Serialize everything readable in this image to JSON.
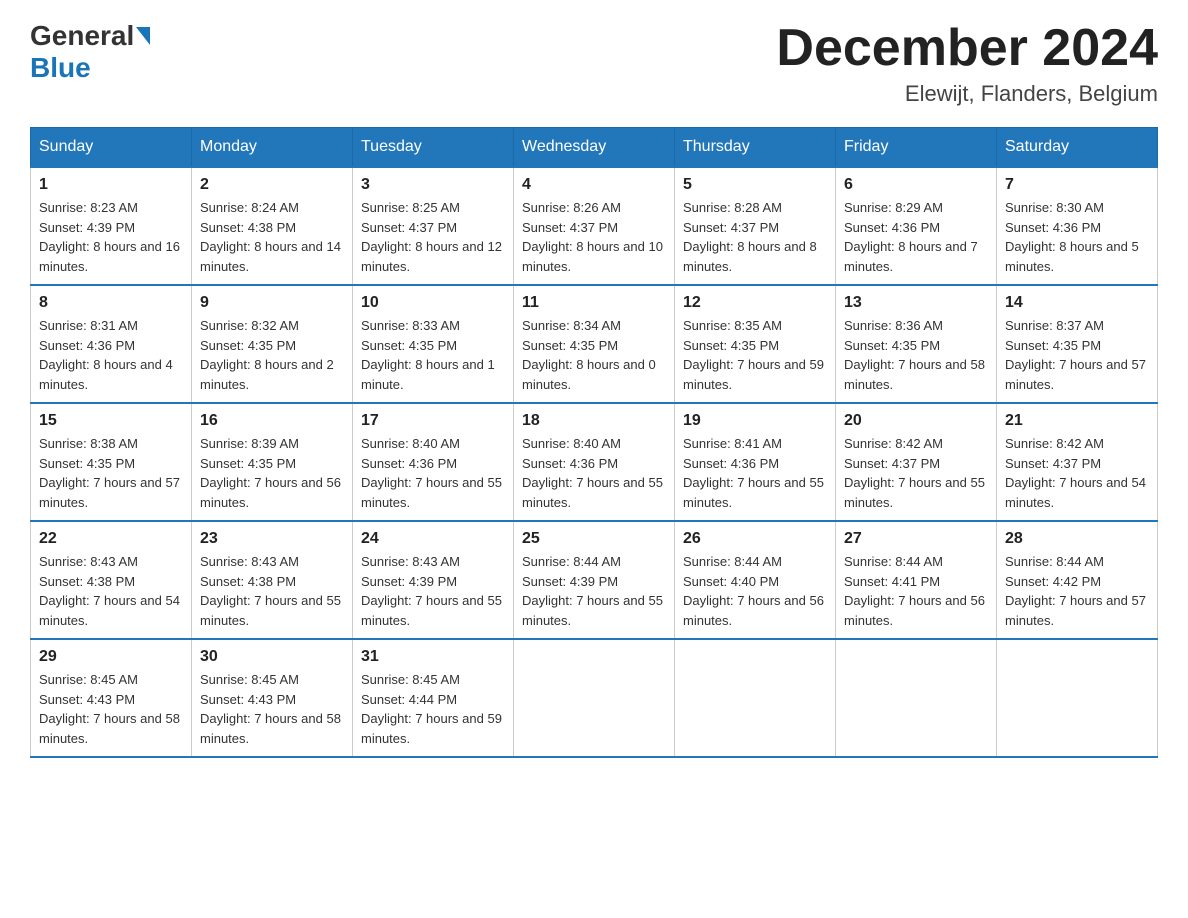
{
  "header": {
    "logo_general": "General",
    "logo_blue": "Blue",
    "month_title": "December 2024",
    "location": "Elewijt, Flanders, Belgium"
  },
  "days_of_week": [
    "Sunday",
    "Monday",
    "Tuesday",
    "Wednesday",
    "Thursday",
    "Friday",
    "Saturday"
  ],
  "weeks": [
    [
      {
        "day": "1",
        "sunrise": "8:23 AM",
        "sunset": "4:39 PM",
        "daylight": "8 hours and 16 minutes."
      },
      {
        "day": "2",
        "sunrise": "8:24 AM",
        "sunset": "4:38 PM",
        "daylight": "8 hours and 14 minutes."
      },
      {
        "day": "3",
        "sunrise": "8:25 AM",
        "sunset": "4:37 PM",
        "daylight": "8 hours and 12 minutes."
      },
      {
        "day": "4",
        "sunrise": "8:26 AM",
        "sunset": "4:37 PM",
        "daylight": "8 hours and 10 minutes."
      },
      {
        "day": "5",
        "sunrise": "8:28 AM",
        "sunset": "4:37 PM",
        "daylight": "8 hours and 8 minutes."
      },
      {
        "day": "6",
        "sunrise": "8:29 AM",
        "sunset": "4:36 PM",
        "daylight": "8 hours and 7 minutes."
      },
      {
        "day": "7",
        "sunrise": "8:30 AM",
        "sunset": "4:36 PM",
        "daylight": "8 hours and 5 minutes."
      }
    ],
    [
      {
        "day": "8",
        "sunrise": "8:31 AM",
        "sunset": "4:36 PM",
        "daylight": "8 hours and 4 minutes."
      },
      {
        "day": "9",
        "sunrise": "8:32 AM",
        "sunset": "4:35 PM",
        "daylight": "8 hours and 2 minutes."
      },
      {
        "day": "10",
        "sunrise": "8:33 AM",
        "sunset": "4:35 PM",
        "daylight": "8 hours and 1 minute."
      },
      {
        "day": "11",
        "sunrise": "8:34 AM",
        "sunset": "4:35 PM",
        "daylight": "8 hours and 0 minutes."
      },
      {
        "day": "12",
        "sunrise": "8:35 AM",
        "sunset": "4:35 PM",
        "daylight": "7 hours and 59 minutes."
      },
      {
        "day": "13",
        "sunrise": "8:36 AM",
        "sunset": "4:35 PM",
        "daylight": "7 hours and 58 minutes."
      },
      {
        "day": "14",
        "sunrise": "8:37 AM",
        "sunset": "4:35 PM",
        "daylight": "7 hours and 57 minutes."
      }
    ],
    [
      {
        "day": "15",
        "sunrise": "8:38 AM",
        "sunset": "4:35 PM",
        "daylight": "7 hours and 57 minutes."
      },
      {
        "day": "16",
        "sunrise": "8:39 AM",
        "sunset": "4:35 PM",
        "daylight": "7 hours and 56 minutes."
      },
      {
        "day": "17",
        "sunrise": "8:40 AM",
        "sunset": "4:36 PM",
        "daylight": "7 hours and 55 minutes."
      },
      {
        "day": "18",
        "sunrise": "8:40 AM",
        "sunset": "4:36 PM",
        "daylight": "7 hours and 55 minutes."
      },
      {
        "day": "19",
        "sunrise": "8:41 AM",
        "sunset": "4:36 PM",
        "daylight": "7 hours and 55 minutes."
      },
      {
        "day": "20",
        "sunrise": "8:42 AM",
        "sunset": "4:37 PM",
        "daylight": "7 hours and 55 minutes."
      },
      {
        "day": "21",
        "sunrise": "8:42 AM",
        "sunset": "4:37 PM",
        "daylight": "7 hours and 54 minutes."
      }
    ],
    [
      {
        "day": "22",
        "sunrise": "8:43 AM",
        "sunset": "4:38 PM",
        "daylight": "7 hours and 54 minutes."
      },
      {
        "day": "23",
        "sunrise": "8:43 AM",
        "sunset": "4:38 PM",
        "daylight": "7 hours and 55 minutes."
      },
      {
        "day": "24",
        "sunrise": "8:43 AM",
        "sunset": "4:39 PM",
        "daylight": "7 hours and 55 minutes."
      },
      {
        "day": "25",
        "sunrise": "8:44 AM",
        "sunset": "4:39 PM",
        "daylight": "7 hours and 55 minutes."
      },
      {
        "day": "26",
        "sunrise": "8:44 AM",
        "sunset": "4:40 PM",
        "daylight": "7 hours and 56 minutes."
      },
      {
        "day": "27",
        "sunrise": "8:44 AM",
        "sunset": "4:41 PM",
        "daylight": "7 hours and 56 minutes."
      },
      {
        "day": "28",
        "sunrise": "8:44 AM",
        "sunset": "4:42 PM",
        "daylight": "7 hours and 57 minutes."
      }
    ],
    [
      {
        "day": "29",
        "sunrise": "8:45 AM",
        "sunset": "4:43 PM",
        "daylight": "7 hours and 58 minutes."
      },
      {
        "day": "30",
        "sunrise": "8:45 AM",
        "sunset": "4:43 PM",
        "daylight": "7 hours and 58 minutes."
      },
      {
        "day": "31",
        "sunrise": "8:45 AM",
        "sunset": "4:44 PM",
        "daylight": "7 hours and 59 minutes."
      },
      null,
      null,
      null,
      null
    ]
  ],
  "labels": {
    "sunrise": "Sunrise:",
    "sunset": "Sunset:",
    "daylight": "Daylight:"
  }
}
